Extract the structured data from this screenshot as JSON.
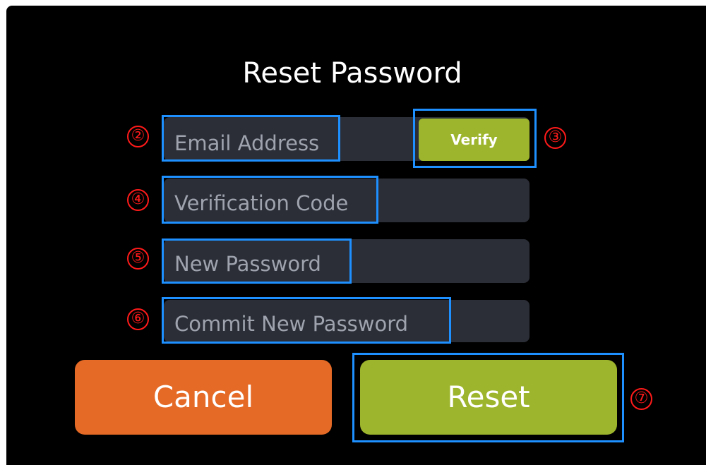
{
  "dialog": {
    "title": "Reset Password",
    "background": "#000000"
  },
  "fields": {
    "email": {
      "placeholder": "Email Address",
      "value": ""
    },
    "verification_code": {
      "placeholder": "Verification Code",
      "value": ""
    },
    "new_password": {
      "placeholder": "New Password",
      "value": ""
    },
    "commit_password": {
      "placeholder": "Commit New Password",
      "value": ""
    }
  },
  "buttons": {
    "verify_label": "Verify",
    "cancel_label": "Cancel",
    "reset_label": "Reset"
  },
  "annotations": {
    "markers": [
      "②",
      "③",
      "④",
      "⑤",
      "⑥",
      "⑦"
    ]
  },
  "colors": {
    "field_bg": "#2b2e37",
    "placeholder_text": "#9ea3ad",
    "accent_green": "#9db52c",
    "cancel_orange": "#e56a26",
    "annotation_blue": "#1e90ff",
    "annotation_red": "#ff1a1a"
  }
}
